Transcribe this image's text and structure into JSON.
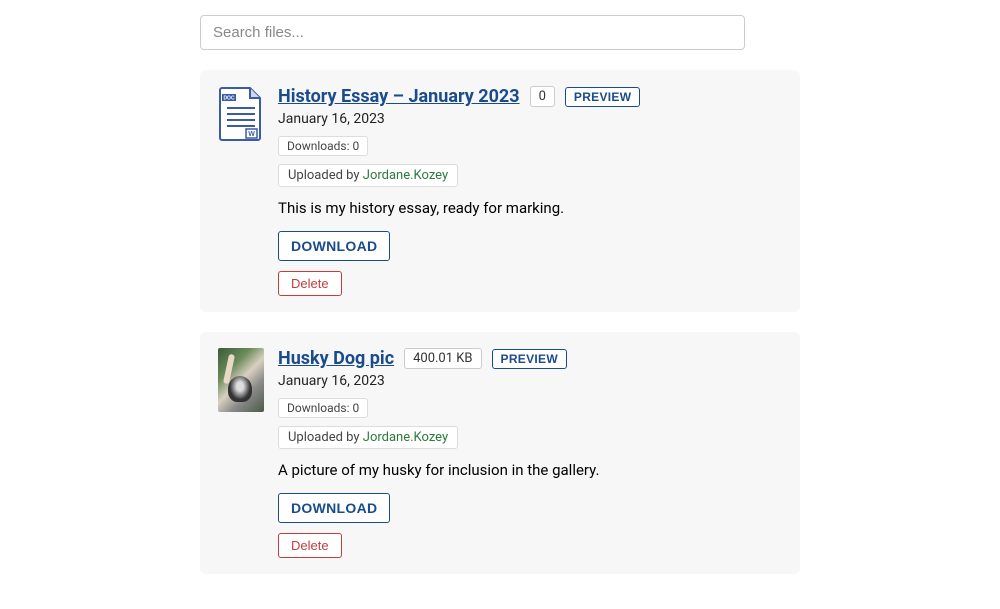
{
  "search": {
    "placeholder": "Search files..."
  },
  "labels": {
    "preview": "PREVIEW",
    "downloads_prefix": "Downloads: ",
    "uploaded_prefix": "Uploaded by ",
    "download": "DOWNLOAD",
    "delete": "Delete"
  },
  "files": [
    {
      "icon_type": "doc",
      "title": "History Essay – January 2023",
      "size": "0",
      "date": "January 16, 2023",
      "downloads": "0",
      "uploader": "Jordane.Kozey",
      "description": "This is my history essay, ready for marking."
    },
    {
      "icon_type": "image",
      "title": "Husky Dog pic",
      "size": "400.01 KB",
      "date": "January 16, 2023",
      "downloads": "0",
      "uploader": "Jordane.Kozey",
      "description": "A picture of my husky for inclusion in the gallery."
    }
  ]
}
